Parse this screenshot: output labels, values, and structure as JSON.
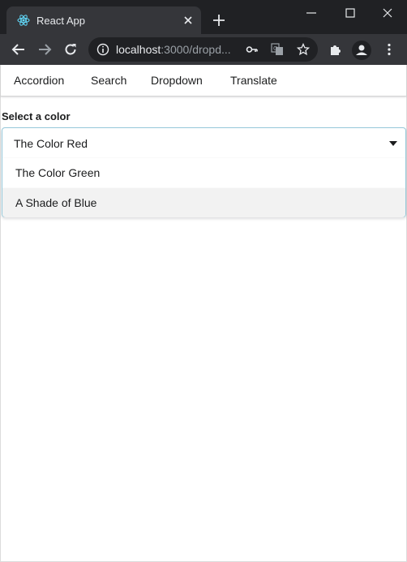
{
  "browser": {
    "tab_title": "React App",
    "url_host": "localhost",
    "url_rest": ":3000/dropd...",
    "icons": [
      "react-icon",
      "close-icon",
      "plus-icon",
      "minimize-icon",
      "maximize-icon",
      "window-close-icon",
      "back-arrow-icon",
      "forward-arrow-icon",
      "reload-icon",
      "info-icon",
      "key-icon",
      "translate-icon",
      "star-icon",
      "puzzle-icon",
      "account-icon",
      "more-vert-icon"
    ]
  },
  "nav": {
    "items": [
      {
        "label": "Accordion"
      },
      {
        "label": "Search"
      },
      {
        "label": "Dropdown"
      },
      {
        "label": "Translate"
      }
    ]
  },
  "dropdown": {
    "label": "Select a color",
    "selected": "The Color Red",
    "options": [
      {
        "label": "The Color Green"
      },
      {
        "label": "A Shade of Blue"
      }
    ]
  },
  "colors": {
    "chrome_dark": "#202124",
    "chrome_toolbar": "#35363a",
    "dropdown_border": "#96c8da",
    "option_hover": "#f2f2f2"
  }
}
